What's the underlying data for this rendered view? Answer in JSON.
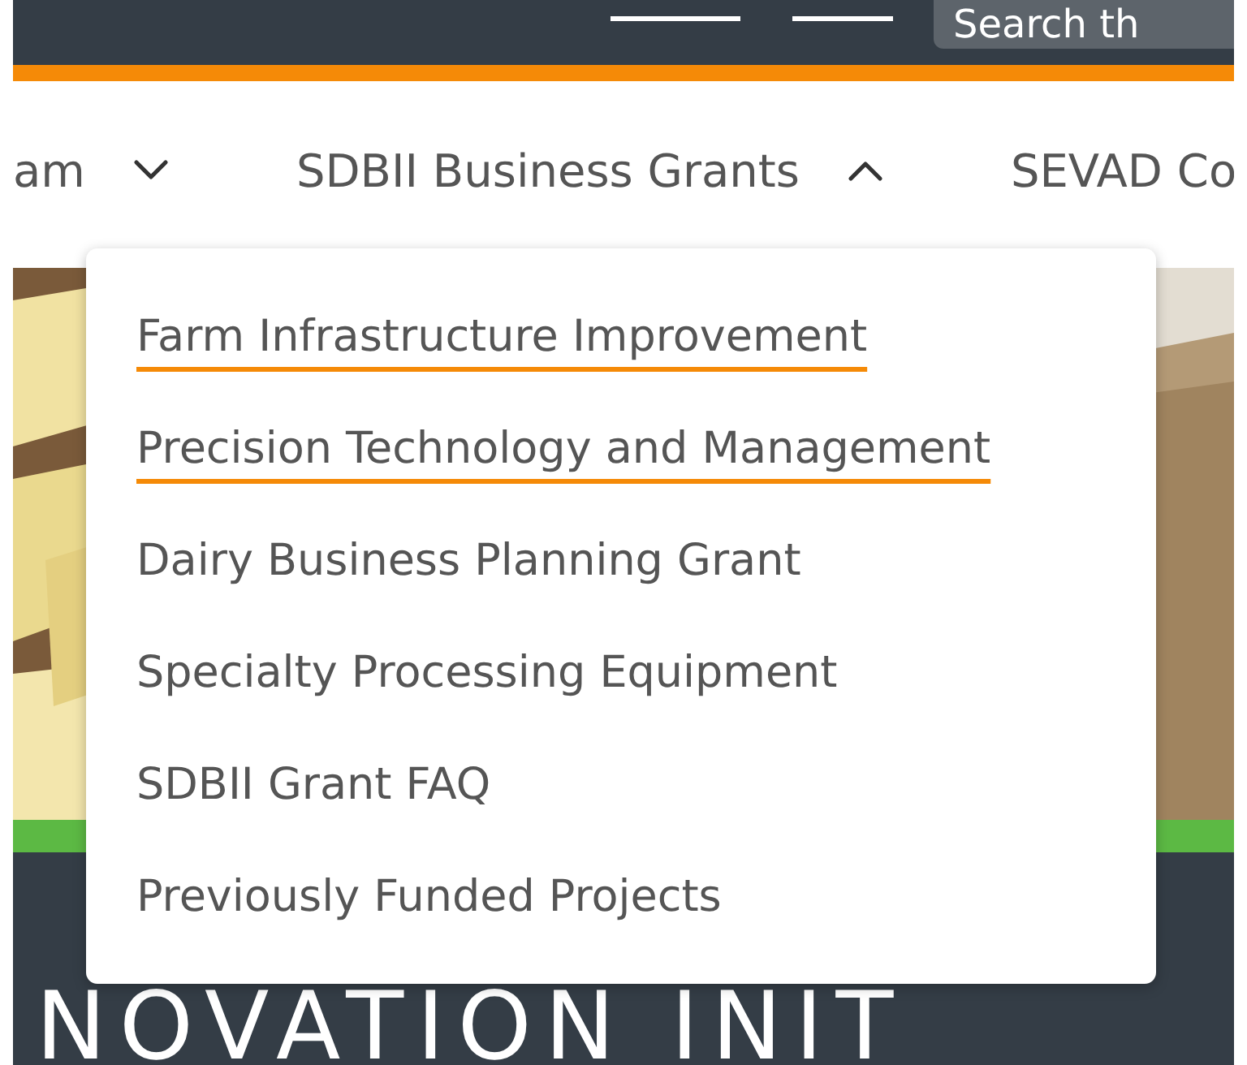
{
  "top_bar": {
    "search": {
      "placeholder": "Search th"
    }
  },
  "nav": {
    "items": [
      {
        "label": "am",
        "expanded": false
      },
      {
        "label": "SDBII Business Grants",
        "expanded": true
      },
      {
        "label": "SEVAD Co"
      }
    ]
  },
  "dropdown": {
    "items": [
      {
        "label": "Farm Infrastructure Improvement",
        "underlined": true
      },
      {
        "label": "Precision Technology and Management",
        "underlined": true
      },
      {
        "label": "Dairy Business Planning Grant",
        "underlined": false
      },
      {
        "label": "Specialty Processing Equipment",
        "underlined": false
      },
      {
        "label": "SDBII Grant FAQ",
        "underlined": false
      },
      {
        "label": "Previously Funded Projects",
        "underlined": false
      }
    ]
  },
  "hero": {
    "heading": "NOVATION INIT"
  }
}
